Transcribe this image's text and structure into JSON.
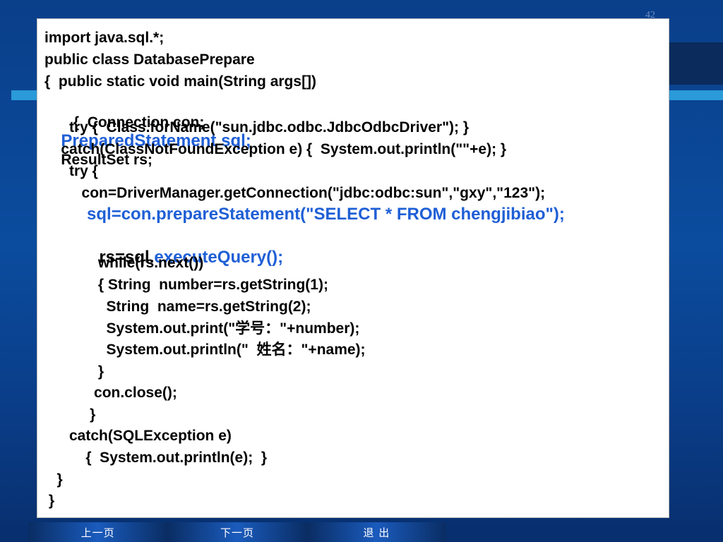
{
  "slide": {
    "page_number": "42",
    "code_lines": [
      "import java.sql.*;",
      "public class DatabasePrepare",
      "{  public static void main(String args[])",
      "   {  Connection con;",
      "PreparedStatement sql;",
      "ResultSet rs;",
      "      try {  Class.forName(\"sun.jdbc.odbc.JdbcOdbcDriver\"); }",
      "    catch(ClassNotFoundException e) {  System.out.println(\"\"+e); }",
      "      try {",
      "         con=DriverManager.getConnection(\"jdbc:odbc:sun\",\"gxy\",\"123\");",
      "         sql=con.prepareStatement(\"SELECT * FROM chengjibiao\");",
      "rs=sql.",
      "executeQuery();",
      "             while(rs.next())",
      "             { String  number=rs.getString(1);",
      "               String  name=rs.getString(2);",
      "               System.out.print(\"学号：\"+number);",
      "               System.out.println(\"  姓名：\"+name);",
      "             }",
      "            con.close();",
      "           }",
      "      catch(SQLException e)",
      "          {  System.out.println(e);  }",
      "   }",
      " }"
    ]
  },
  "nav": {
    "prev_label": "上一页",
    "next_label": "下一页",
    "exit_label": "退  出"
  },
  "colors": {
    "highlight": "#1f5fd6",
    "background": "#0b4c9e"
  }
}
